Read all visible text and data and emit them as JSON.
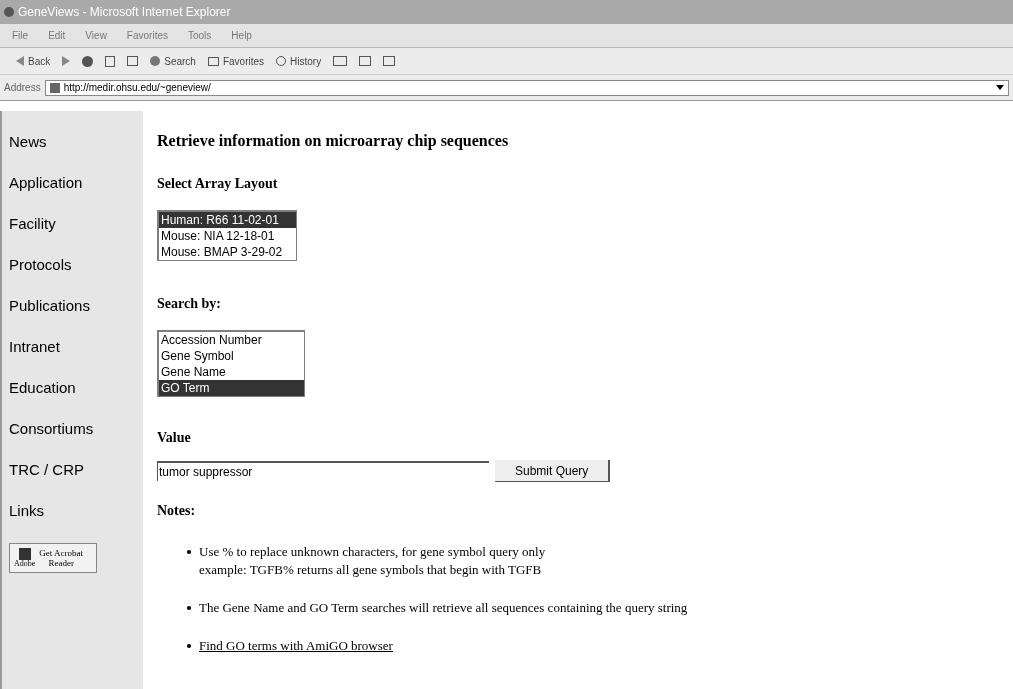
{
  "window": {
    "title": "GeneViews - Microsoft Internet Explorer"
  },
  "menu": [
    "File",
    "Edit",
    "View",
    "Favorites",
    "Tools",
    "Help"
  ],
  "toolbar": {
    "back": "Back",
    "search": "Search",
    "favorites": "Favorites",
    "history": "History"
  },
  "address": {
    "label": "Address",
    "url": "http://medir.ohsu.edu/~geneview/"
  },
  "sidebar": {
    "items": [
      "News",
      "Application",
      "Facility",
      "Protocols",
      "Publications",
      "Intranet",
      "Education",
      "Consortiums",
      "TRC / CRP",
      "Links"
    ],
    "badge": {
      "line1": "Get Acrobat",
      "line2": "Reader",
      "brand": "Adobe"
    }
  },
  "heading": "Retrieve information on microarray chip sequences",
  "layout": {
    "label": "Select Array Layout",
    "options": [
      {
        "label": "Human: R66 11-02-01",
        "selected": true
      },
      {
        "label": "Mouse: NIA 12-18-01",
        "selected": false
      },
      {
        "label": "Mouse: BMAP 3-29-02",
        "selected": false
      }
    ]
  },
  "search_by": {
    "label": "Search by:",
    "options": [
      {
        "label": "Accession Number",
        "selected": false
      },
      {
        "label": "Gene Symbol",
        "selected": false
      },
      {
        "label": "Gene Name",
        "selected": false
      },
      {
        "label": "GO Term",
        "selected": true
      }
    ]
  },
  "value": {
    "label": "Value",
    "value": "tumor suppressor",
    "button": "Submit Query"
  },
  "notes": {
    "label": "Notes:",
    "items": [
      {
        "kind": "text",
        "lines": [
          "Use % to replace unknown characters, for gene symbol query only",
          "example: TGFB% returns all gene symbols that begin with TGFB"
        ]
      },
      {
        "kind": "text",
        "lines": [
          "The Gene Name and GO Term searches will retrieve all sequences containing the query string"
        ]
      },
      {
        "kind": "link",
        "lines": [
          "Find GO terms with AmiGO browser"
        ]
      }
    ]
  }
}
